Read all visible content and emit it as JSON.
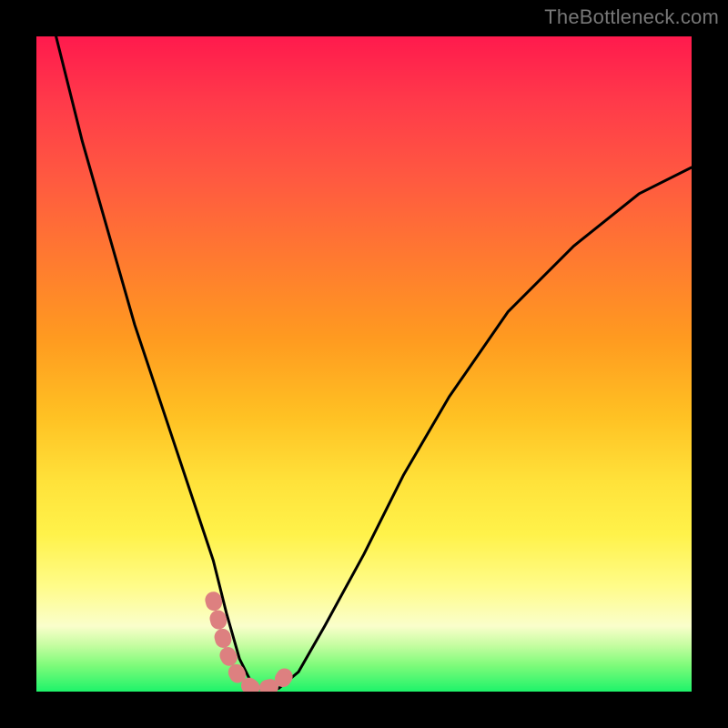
{
  "watermark": "TheBottleneck.com",
  "chart_data": {
    "type": "line",
    "title": "",
    "xlabel": "",
    "ylabel": "",
    "xlim": [
      0,
      100
    ],
    "ylim": [
      0,
      100
    ],
    "grid": false,
    "legend": false,
    "series": [
      {
        "name": "bottleneck-curve",
        "x": [
          3,
          7,
          11,
          15,
          19,
          23,
          27,
          29,
          31,
          33,
          35,
          37,
          40,
          44,
          50,
          56,
          63,
          72,
          82,
          92,
          100
        ],
        "y": [
          100,
          84,
          70,
          56,
          44,
          32,
          20,
          12,
          5,
          1,
          0,
          0.5,
          3,
          10,
          21,
          33,
          45,
          58,
          68,
          76,
          80
        ],
        "color": "#000000"
      }
    ],
    "highlight_segment": {
      "name": "valley-overlay",
      "x": [
        27,
        29,
        31,
        33,
        35,
        37,
        39
      ],
      "y": [
        14,
        6,
        2,
        0.5,
        0.5,
        1,
        4
      ],
      "color": "#dd8080"
    },
    "notes": "Axes are unlabeled in the source image; x and y are normalized 0–100. The curve is a steep V plunging to the green zone around x≈34 then rising more slowly. A thick pale-red overlay marks the valley floor (best/no-bottleneck region)."
  }
}
